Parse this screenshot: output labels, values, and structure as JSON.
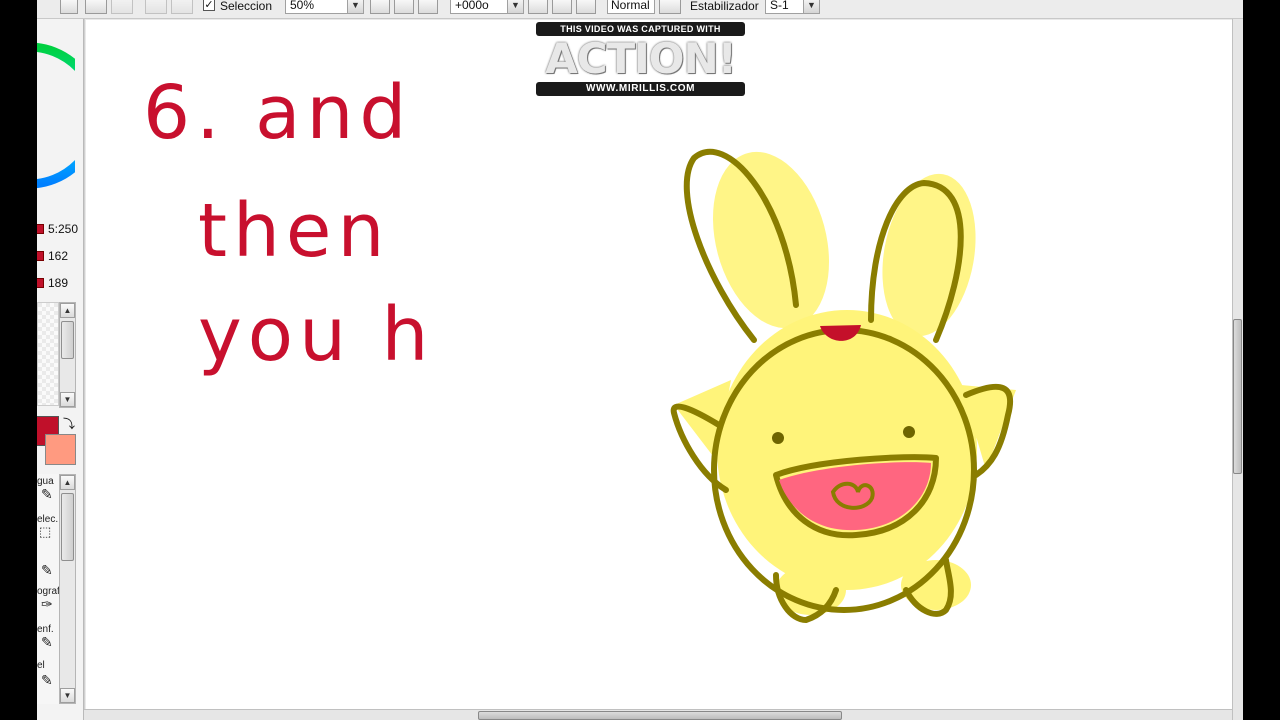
{
  "toolbar": {
    "selection_label": "Seleccion",
    "selection_checked": "✓",
    "zoom_value": "50%",
    "rotation_value": "+000o",
    "blend_mode": "Normal",
    "stabilizer_label": "Estabilizador",
    "stabilizer_value": "S-1"
  },
  "left_panel": {
    "color_values": [
      "5:250",
      "162",
      "189"
    ],
    "primary_color": "#c0102a",
    "secondary_color": "#ff9a80",
    "tools": [
      "gua",
      "elec.",
      "ografi",
      "enf.",
      "el"
    ]
  },
  "canvas": {
    "handwriting": [
      "6. and",
      "then",
      "you h"
    ],
    "ink_color": "#c8102e"
  },
  "watermark": {
    "top_text": "THIS VIDEO WAS CAPTURED WITH",
    "logo_text": "ACTION!",
    "bottom_text": "WWW.MIRILLIS.COM"
  }
}
